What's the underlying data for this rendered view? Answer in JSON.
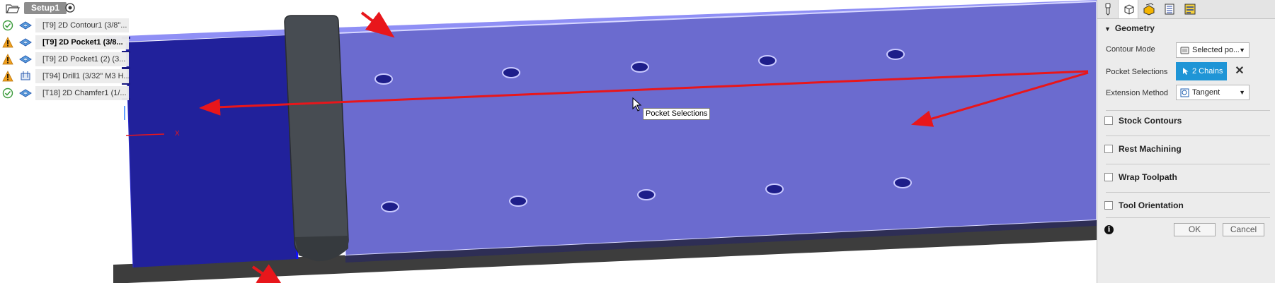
{
  "browser": {
    "setup_label": "Setup1",
    "operations": [
      {
        "label": "[T9] 2D Contour1 (3/8\"...",
        "status": "ok",
        "icon": "2d-contour-icon",
        "bold": false
      },
      {
        "label": "[T9] 2D Pocket1 (3/8...",
        "status": "warning",
        "icon": "2d-pocket-icon",
        "bold": true
      },
      {
        "label": "[T9] 2D Pocket1 (2) (3...",
        "status": "warning",
        "icon": "2d-pocket-icon",
        "bold": false
      },
      {
        "label": "[T94] Drill1 (3/32\" M3 H...",
        "status": "warning",
        "icon": "drill-icon",
        "bold": false
      },
      {
        "label": "[T18] 2D Chamfer1 (1/...",
        "status": "ok",
        "icon": "2d-chamfer-icon",
        "bold": false
      }
    ]
  },
  "viewport": {
    "tooltip": "Pocket Selections",
    "axis_label": "X"
  },
  "panel": {
    "tabs": [
      "tool-tab",
      "geometry-tab",
      "heights-tab",
      "passes-tab",
      "linking-tab"
    ],
    "geometry": {
      "title": "Geometry",
      "contour_mode_label": "Contour Mode",
      "contour_mode_value": "Selected po...",
      "pocket_selections_label": "Pocket Selections",
      "pocket_selections_value": "2 Chains",
      "extension_method_label": "Extension Method",
      "extension_method_value": "Tangent"
    },
    "sections": [
      {
        "label": "Stock Contours",
        "checked": false
      },
      {
        "label": "Rest Machining",
        "checked": false
      },
      {
        "label": "Wrap Toolpath",
        "checked": false
      },
      {
        "label": "Tool Orientation",
        "checked": false
      }
    ],
    "ok_label": "OK",
    "cancel_label": "Cancel"
  },
  "colors": {
    "accent": "#1f95d6",
    "pocket_face": "#6b6bcf",
    "selected_face": "#21219b",
    "warning": "#f0a020",
    "ok": "#3a9a3a",
    "annotation": "#e8161b"
  }
}
